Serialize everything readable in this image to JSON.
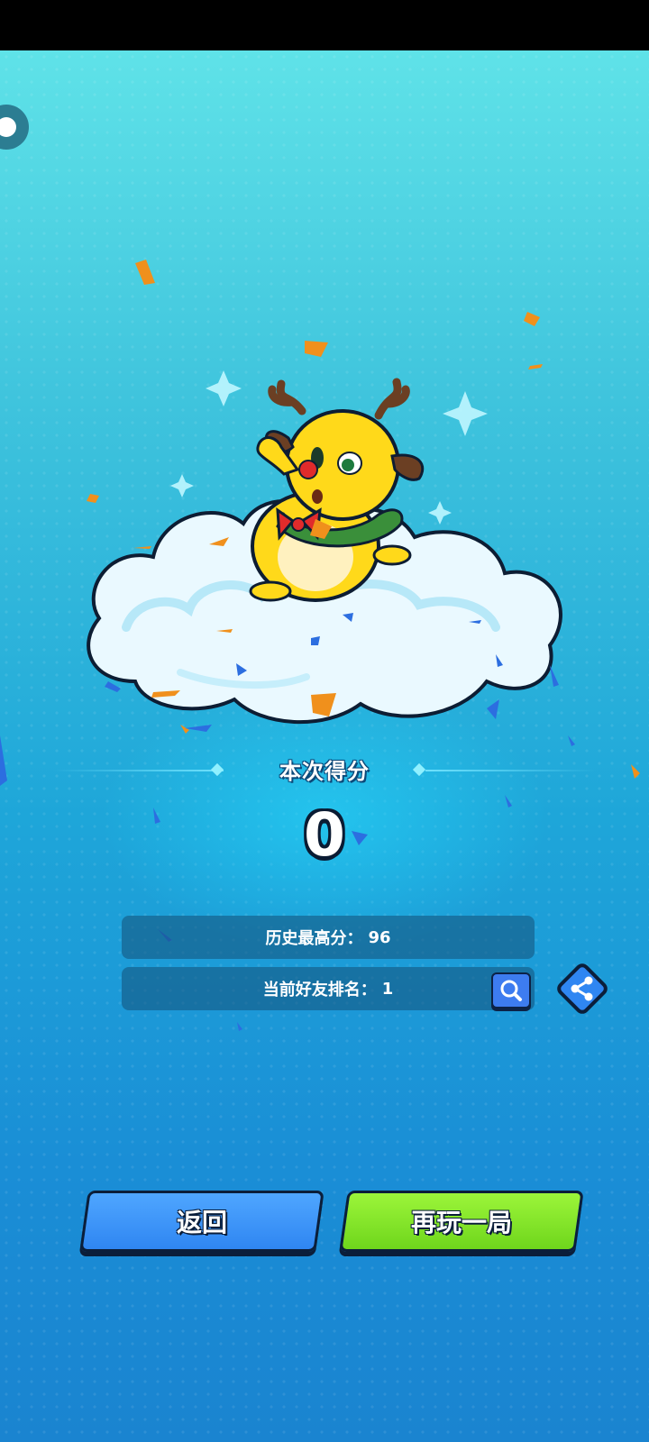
{
  "result": {
    "score_title": "本次得分",
    "score_value": "0",
    "high_score_label": "历史最高分：",
    "high_score_value": "96",
    "rank_label": "当前好友排名：",
    "rank_value": "1"
  },
  "buttons": {
    "back": "返回",
    "play_again": "再玩一局"
  },
  "icons": {
    "corner": "circle-button-icon",
    "search": "magnifier-icon",
    "share": "share-icon"
  },
  "colors": {
    "back_button": "#3d95fb",
    "play_again_button": "#8be82c",
    "background_top": "#5fe2e8",
    "background_bottom": "#1a84d0"
  }
}
